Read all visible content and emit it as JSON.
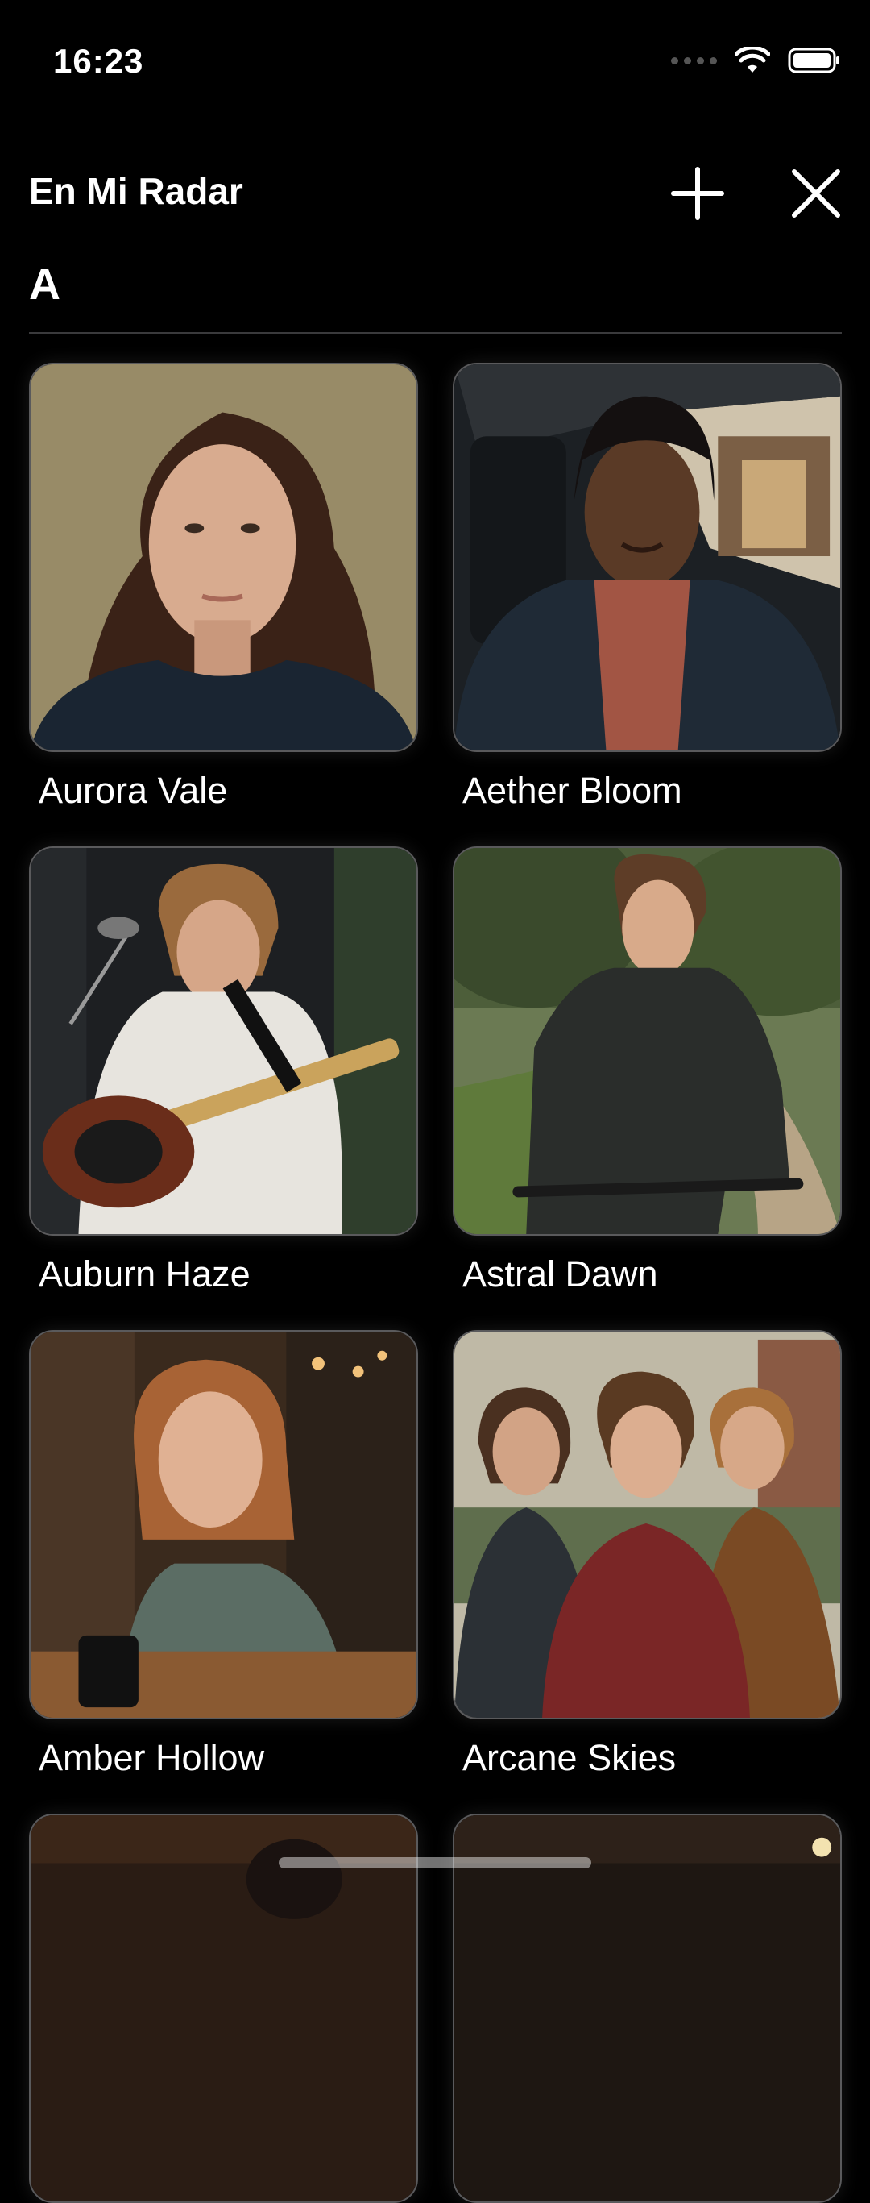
{
  "status_bar": {
    "time": "16:23",
    "icons": [
      "signal-dots-icon",
      "wifi-icon",
      "battery-icon"
    ]
  },
  "header": {
    "title": "En Mi Radar",
    "add_icon": "plus-icon",
    "close_icon": "close-icon"
  },
  "section": {
    "letter": "A"
  },
  "artists": [
    {
      "name": "Aurora Vale"
    },
    {
      "name": "Aether Bloom"
    },
    {
      "name": "Auburn Haze"
    },
    {
      "name": "Astral Dawn"
    },
    {
      "name": "Amber Hollow"
    },
    {
      "name": "Arcane Skies"
    },
    {
      "name": ""
    },
    {
      "name": ""
    }
  ],
  "colors": {
    "background": "#000000",
    "text": "#ffffff",
    "divider": "#3a3a3c",
    "card_border": "#5a5a5c"
  }
}
